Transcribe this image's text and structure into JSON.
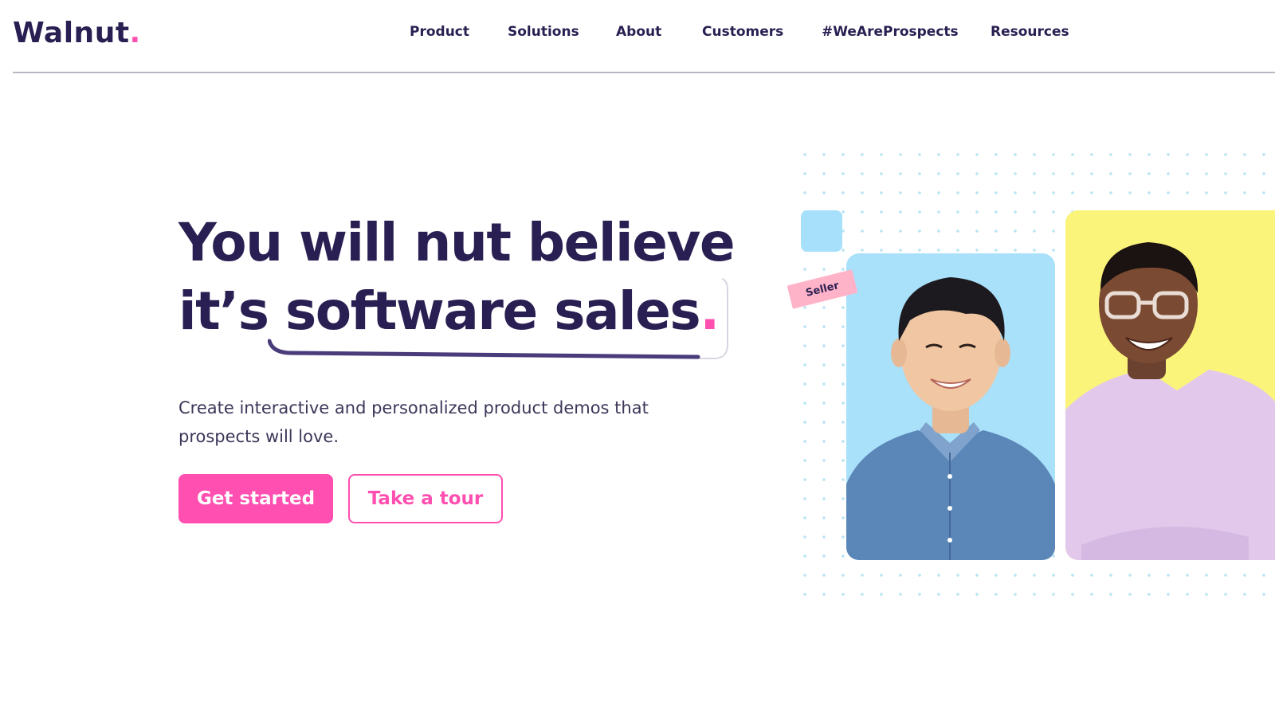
{
  "brand": {
    "name": "Walnut",
    "dot": ".",
    "accent_color": "#ff4fb0",
    "text_color": "#2a1f52"
  },
  "nav": {
    "items": [
      {
        "label": "Product"
      },
      {
        "label": "Solutions"
      },
      {
        "label": "About"
      },
      {
        "label": "Customers"
      },
      {
        "label": "#WeAreProspects"
      },
      {
        "label": "Resources"
      }
    ]
  },
  "hero": {
    "headline_line1": "You will nut believe",
    "headline_line2_prefix": "it’s ",
    "headline_line2_highlight": "software sales",
    "headline_period": ".",
    "subtitle": "Create interactive and personalized product demos that prospects will love.",
    "primary_cta": "Get started",
    "secondary_cta": "Take a tour"
  },
  "illustration": {
    "tag_label": "Seller",
    "card_colors": {
      "blue": "#a9e1fb",
      "yellow": "#fbf47a",
      "square": "#a7e0fb",
      "tag": "#ffb3c9"
    }
  }
}
